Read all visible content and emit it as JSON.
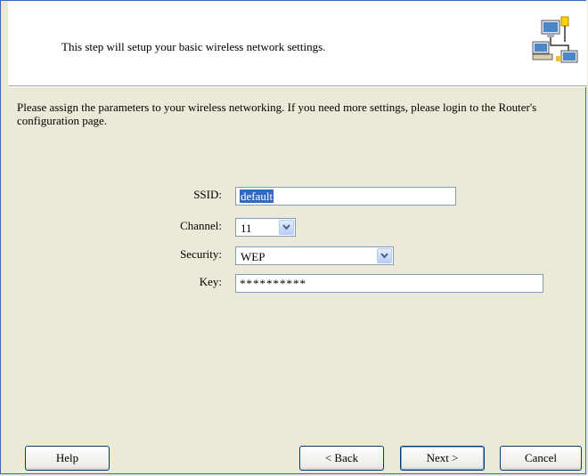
{
  "header": {
    "step_text": "This step will setup your basic wireless network settings."
  },
  "intro_text": "Please assign the parameters to your wireless networking. If you need more settings, please login to the Router's configuration page.",
  "form": {
    "ssid_label": "SSID:",
    "ssid_value": "default",
    "channel_label": "Channel:",
    "channel_value": "11",
    "security_label": "Security:",
    "security_value": "WEP",
    "key_label": "Key:",
    "key_value": "**********"
  },
  "buttons": {
    "help": "Help",
    "back": "< Back",
    "next": "Next >",
    "cancel": "Cancel"
  },
  "icons": {
    "header_icon": "network-computers-icon",
    "dropdown_arrow": "chevron-down-icon"
  }
}
